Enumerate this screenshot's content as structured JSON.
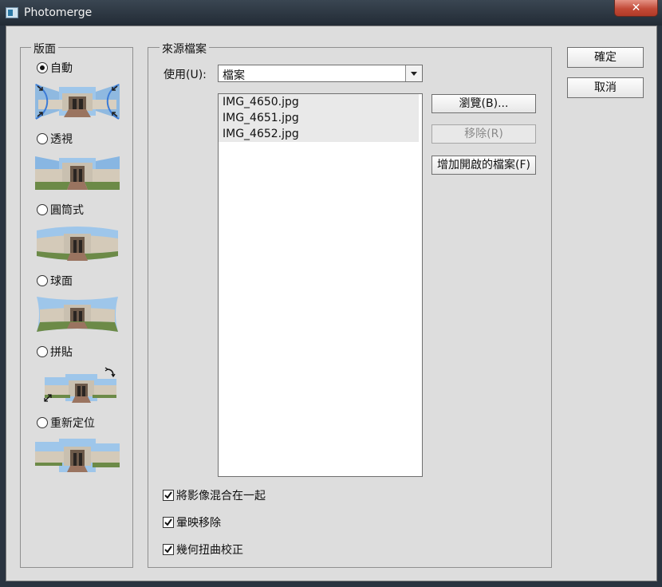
{
  "window": {
    "title": "Photomerge",
    "close_label": "✕"
  },
  "layout_group": {
    "legend": "版面",
    "options": [
      {
        "label": "自動",
        "selected": true
      },
      {
        "label": "透視",
        "selected": false
      },
      {
        "label": "圓筒式",
        "selected": false
      },
      {
        "label": "球面",
        "selected": false
      },
      {
        "label": "拼貼",
        "selected": false
      },
      {
        "label": "重新定位",
        "selected": false
      }
    ]
  },
  "source_group": {
    "legend": "來源檔案",
    "use_label": "使用(U):",
    "use_value": "檔案",
    "files": [
      "IMG_4650.jpg",
      "IMG_4651.jpg",
      "IMG_4652.jpg"
    ],
    "browse_label": "瀏覽(B)...",
    "remove_label": "移除(R)",
    "add_open_label": "增加開啟的檔案(F)",
    "checkboxes": [
      {
        "label": "將影像混合在一起",
        "checked": true
      },
      {
        "label": "暈映移除",
        "checked": true
      },
      {
        "label": "幾何扭曲校正",
        "checked": true
      }
    ]
  },
  "actions": {
    "ok_label": "確定",
    "cancel_label": "取消"
  },
  "icons": [
    "app-icon",
    "close-icon",
    "dropdown-arrow-icon",
    "checkmark-icon",
    "rotate-icon",
    "resize-icon"
  ]
}
